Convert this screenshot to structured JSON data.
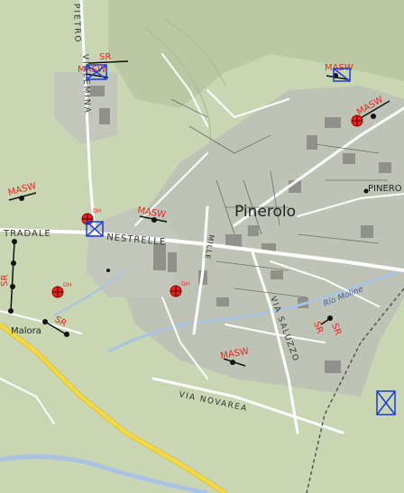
{
  "map": {
    "town_label": "Pinerolo",
    "cut_label": "PINERO",
    "hamlet_label": "Malora",
    "street_labels": {
      "strada": "TRADALE",
      "nestrelle": "NESTRELLE",
      "vialemina": "VIALEMINA",
      "viasaluzzo": "VIA SALUZZO",
      "vianovarea": "VIA NOVAREA",
      "viamiller": "MILLE",
      "riomolino": "Rio Moline",
      "viapietro": "PIETRO"
    }
  },
  "markers": {
    "masw": "MASW",
    "sr": "SR",
    "dh": "DH"
  },
  "colors": {
    "survey": "#e8241c",
    "equipment": "#1c3ad8",
    "point": "#111111",
    "highway": "#f1d94a",
    "river": "#a9c3e3",
    "road": "#ffffff",
    "land": "#c9d6b4",
    "urban": "#b9bdb1"
  }
}
